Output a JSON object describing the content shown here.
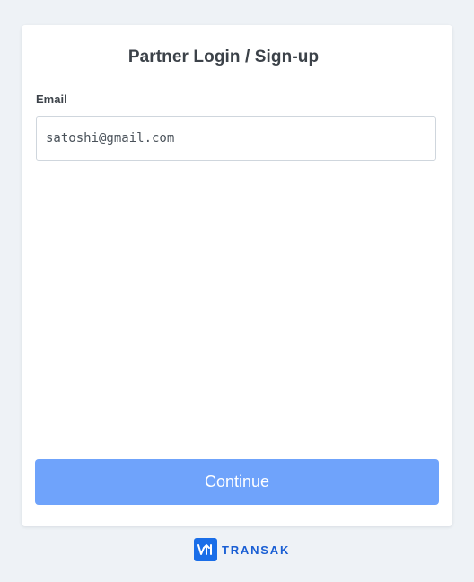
{
  "form": {
    "title": "Partner Login / Sign-up",
    "email_label": "Email",
    "email_value": "satoshi@gmail.com",
    "continue_label": "Continue"
  },
  "brand": {
    "name": "TRANSAK",
    "logo_icon": "transak-arrows-icon",
    "color": "#1a6ee8"
  },
  "colors": {
    "background": "#eef2f6",
    "button": "#6fa3fb",
    "title_text": "#3c4249"
  }
}
